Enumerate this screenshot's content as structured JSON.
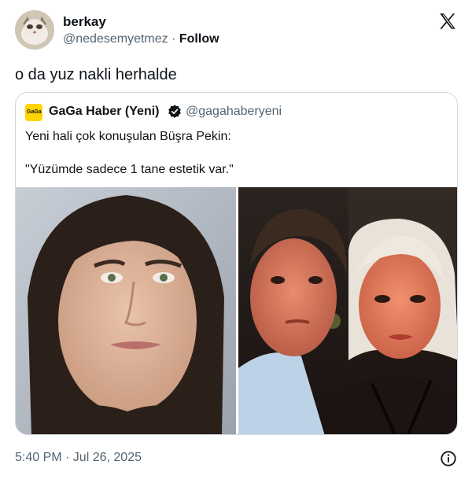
{
  "author": {
    "name": "berkay",
    "handle": "@nedesemyetmez",
    "separator": "·",
    "follow_label": "Follow"
  },
  "tweet": {
    "text": "o da yuz nakli herhalde"
  },
  "quoted": {
    "logo_text": "GaGa",
    "name": "GaGa Haber (Yeni)",
    "handle": "@gagahaberyeni",
    "line1": "Yeni hali çok konuşulan Büşra Pekin:",
    "line2": "\"Yüzümde sadece 1 tane estetik var.\""
  },
  "footer": {
    "timestamp": "5:40 PM · Jul 26, 2025"
  },
  "icons": {
    "x": "x-logo-icon",
    "verified": "verified-badge-icon",
    "info": "info-icon"
  },
  "colors": {
    "text": "#0f1419",
    "secondary": "#536471",
    "border": "#cfd9de",
    "verified": "#e3a100",
    "gaga": "#ffd400"
  }
}
